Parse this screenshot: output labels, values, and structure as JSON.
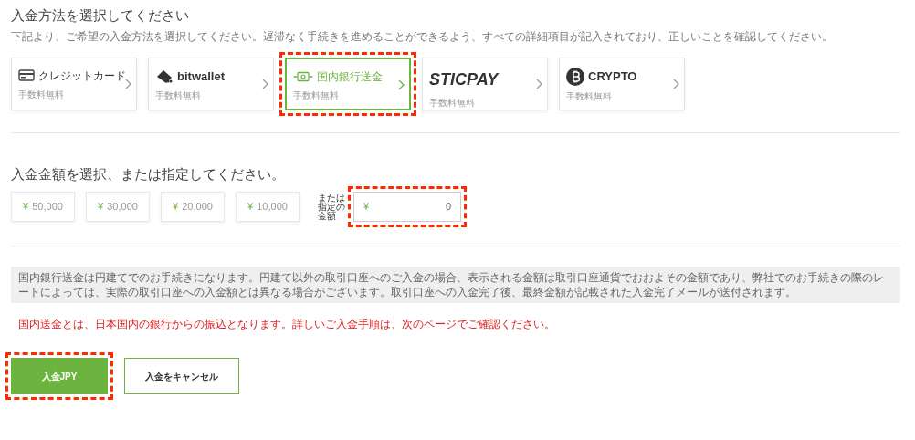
{
  "method_section": {
    "title": "入金方法を選択してください",
    "description": "下記より、ご希望の入金方法を選択してください。遅滞なく手続きを進めることができるよう、すべての詳細項目が記入されており、正しいことを確認してください。",
    "methods": [
      {
        "kind": "card",
        "label": "クレジットカード",
        "fee": "手数料無料",
        "selected": false,
        "highlighted": false
      },
      {
        "kind": "bitwallet",
        "label": "bitwallet",
        "fee": "手数料無料",
        "selected": false,
        "highlighted": false
      },
      {
        "kind": "bank",
        "label": "国内銀行送金",
        "fee": "手数料無料",
        "selected": true,
        "highlighted": true
      },
      {
        "kind": "sticpay",
        "label": "STICPAY",
        "fee": "手数料無料",
        "selected": false,
        "highlighted": false
      },
      {
        "kind": "crypto",
        "label": "CRYPTO",
        "fee": "手数料無料",
        "selected": false,
        "highlighted": false
      }
    ]
  },
  "amount_section": {
    "title": "入金金額を選択、または指定してください。",
    "presets": [
      {
        "currency": "¥",
        "amount": "50,000"
      },
      {
        "currency": "¥",
        "amount": "30,000"
      },
      {
        "currency": "¥",
        "amount": "20,000"
      },
      {
        "currency": "¥",
        "amount": "10,000"
      }
    ],
    "custom": {
      "label": "または指定の金額",
      "currency": "¥",
      "value": "0",
      "highlighted": true
    }
  },
  "notice": "国内銀行送金は円建てでのお手続きになります。円建て以外の取引口座へのご入金の場合、表示される金額は取引口座通貨でおおよその金額であり、弊社でのお手続きの際のレートによっては、実際の取引口座への入金額とは異なる場合がございます。取引口座への入金完了後、最終金額が記載された入金完了メールが送付されます。",
  "warning": "国内送金とは、日本国内の銀行からの振込となります。詳しいご入金手順は、次のページでご確認ください。",
  "buttons": [
    {
      "kind": "primary",
      "label": "入金JPY",
      "highlighted": true
    },
    {
      "kind": "secondary",
      "label": "入金をキャンセル",
      "highlighted": false
    }
  ]
}
